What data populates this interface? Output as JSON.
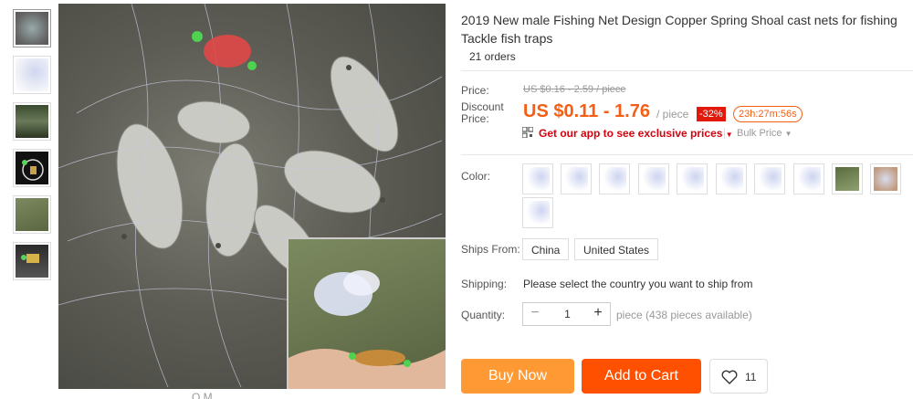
{
  "product": {
    "title": "2019 New male Fishing Net Design Copper Spring Shoal cast nets for fishing Tackle fish traps",
    "orders": "21 orders"
  },
  "gallery": {
    "thumbnail_count": 6,
    "caption": "Q M"
  },
  "price": {
    "price_label": "Price:",
    "old_price": "US $0.16 - 2.59 / piece",
    "discount_label": "Discount Price:",
    "current_price": "US $0.11 - 1.76",
    "unit": "/ piece",
    "discount_badge": "-32%",
    "countdown": "23h:27m:56s",
    "app_promo": "Get our app to see exclusive prices",
    "bulk_price": "Bulk Price"
  },
  "options": {
    "color_label": "Color:",
    "ships_from_label": "Ships From:",
    "ships_from": [
      "China",
      "United States"
    ],
    "shipping_label": "Shipping:",
    "shipping_text": "Please select the country you want to ship from",
    "quantity_label": "Quantity:",
    "quantity_value": "1",
    "availability": "piece (438 pieces available)"
  },
  "actions": {
    "buy_now": "Buy Now",
    "add_to_cart": "Add to Cart",
    "wishlist_count": "11"
  },
  "colors": {
    "price": "#f45f15",
    "promo": "#d8000e",
    "buy_now": "#ff9933",
    "add_to_cart": "#ff5000",
    "discount_badge": "#e2180b"
  }
}
